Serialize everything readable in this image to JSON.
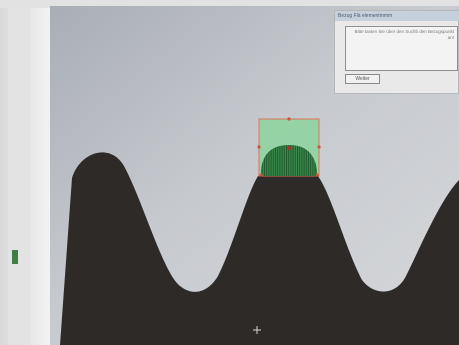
{
  "dialog": {
    "title": "Bezug Flä elementmmm",
    "message": "Bitte tasten Sie über den Suchb den Bezugspunkt an!",
    "button_label": "Weiter"
  },
  "icons": {
    "crosshair": "crosshair-icon"
  },
  "colors": {
    "screen_background": "#bfc3c8",
    "workpiece": "#2e2a28",
    "selection_fill": "#8fd3a0",
    "selection_border": "#e0705a",
    "window_frame": "#efefef"
  }
}
